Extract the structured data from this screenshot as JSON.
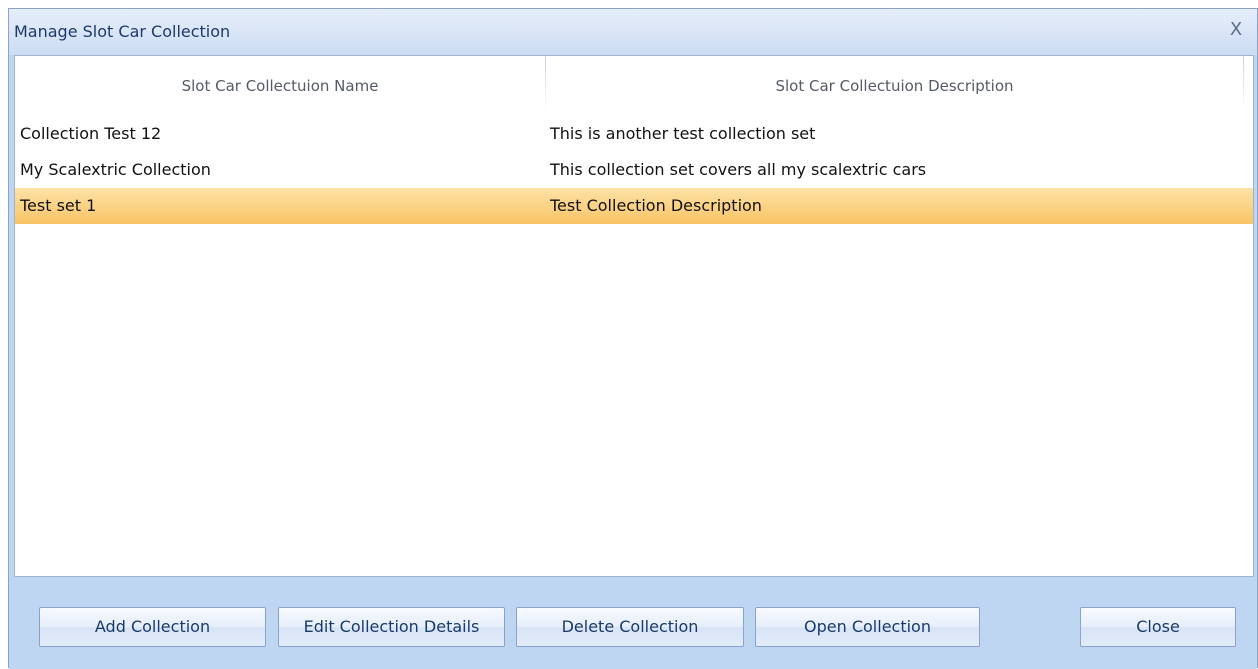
{
  "window": {
    "title": "Manage Slot Car Collection",
    "close_glyph": "X"
  },
  "grid": {
    "columns": [
      "Slot Car Collectuion  Name",
      "Slot Car Collectuion  Description"
    ],
    "rows": [
      {
        "name": "Collection Test 12",
        "description": "This is another test collection set",
        "selected": false
      },
      {
        "name": "My Scalextric Collection",
        "description": "This collection set covers all my scalextric cars",
        "selected": false
      },
      {
        "name": "Test set 1",
        "description": "Test Collection Description",
        "selected": true
      }
    ]
  },
  "buttons": {
    "add": "Add Collection",
    "edit": "Edit Collection Details",
    "delete": "Delete Collection",
    "open": "Open Collection",
    "close": "Close"
  },
  "colors": {
    "window_bg": "#bfd6f3",
    "selected_row": "#f9c465",
    "title_text": "#1e3a6b"
  }
}
